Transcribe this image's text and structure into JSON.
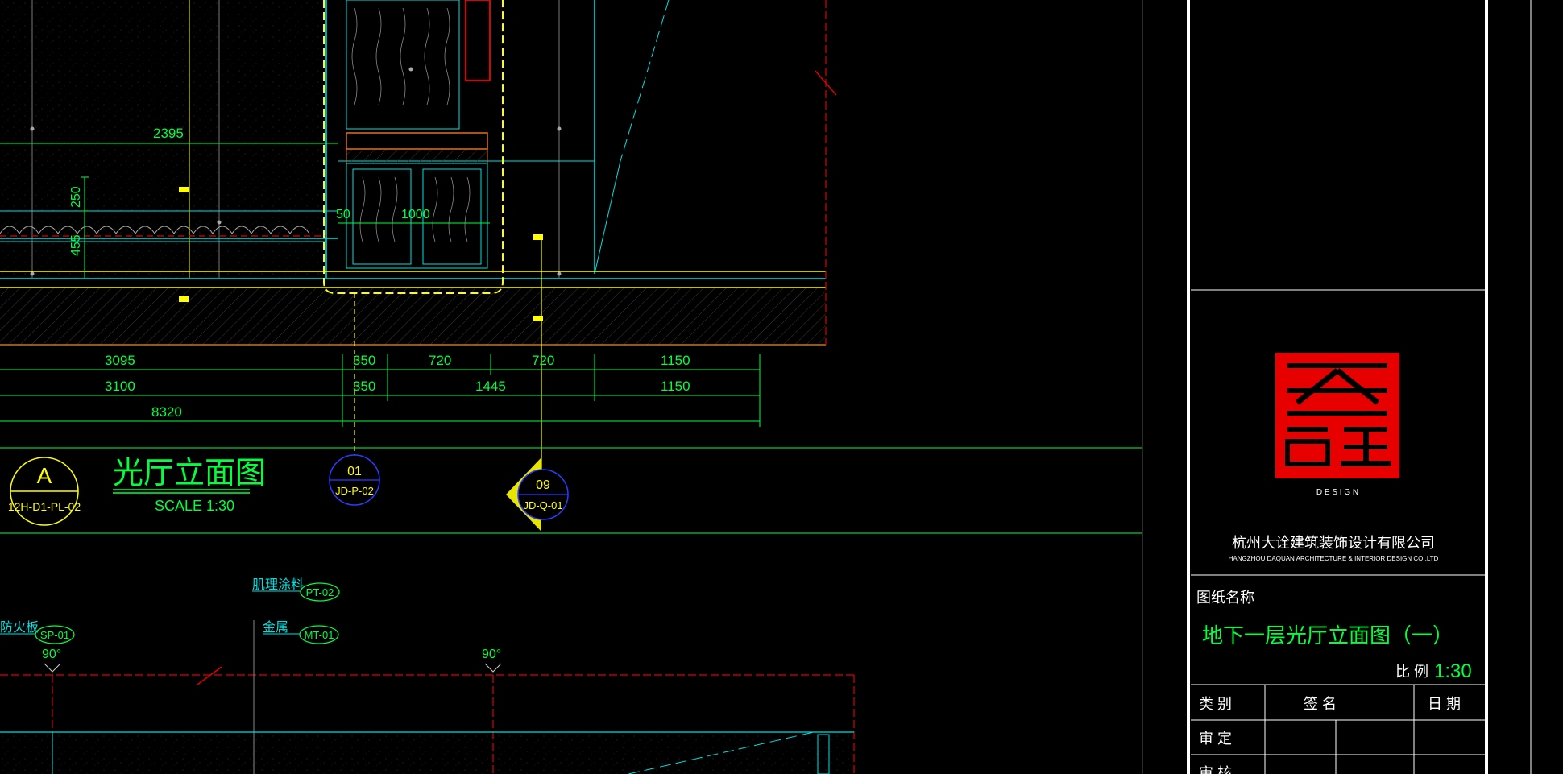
{
  "colors": {
    "background": "#000000",
    "dim_green": "#00ff3c",
    "yellow": "#ffff00",
    "cyan": "#00e0e0",
    "red": "#e00000",
    "white": "#ffffff",
    "blue": "#2a3cff",
    "orange": "#e07020",
    "logo_red": "#e60000"
  },
  "drawing": {
    "dims_upper": {
      "d2395": "2395",
      "d250": "250",
      "d455": "455",
      "d50": "50",
      "d1000": "1000"
    },
    "dims_row1": [
      "3095",
      "350",
      "720",
      "720",
      "1150"
    ],
    "dims_row2": [
      "3100",
      "350",
      "1445",
      "1150"
    ],
    "dims_row3": [
      "8320"
    ],
    "title_tag": {
      "letter": "A",
      "code": "12H-D1-PL-02"
    },
    "title": "光厅立面图",
    "scale": "SCALE  1:30",
    "marker1": {
      "num": "01",
      "code": "JD-P-02"
    },
    "marker2": {
      "num": "09",
      "code": "JD-Q-01"
    },
    "lower_labels": {
      "fire_board": "防火板",
      "fire_board_tag": "SP-01",
      "texture_paint": "肌理涂料",
      "texture_paint_tag": "PT-02",
      "metal": "金属",
      "metal_tag": "MT-01",
      "angle1": "90°",
      "angle2": "90°"
    }
  },
  "title_block": {
    "logo_sub": "D  E  S  I  G  N",
    "company_cn": "杭州大诠建筑装饰设计有限公司",
    "company_en": "HANGZHOU DAQUAN ARCHITECTURE & INTERIOR DESIGN CO.,LTD",
    "drawing_name_label": "图纸名称",
    "drawing_name": "地下一层光厅立面图（一）",
    "scale_label": "比 例",
    "scale_value": "1:30",
    "table_headers": [
      "类  别",
      "签    名",
      "日 期"
    ],
    "rows": [
      "审  定",
      "审  核"
    ]
  }
}
